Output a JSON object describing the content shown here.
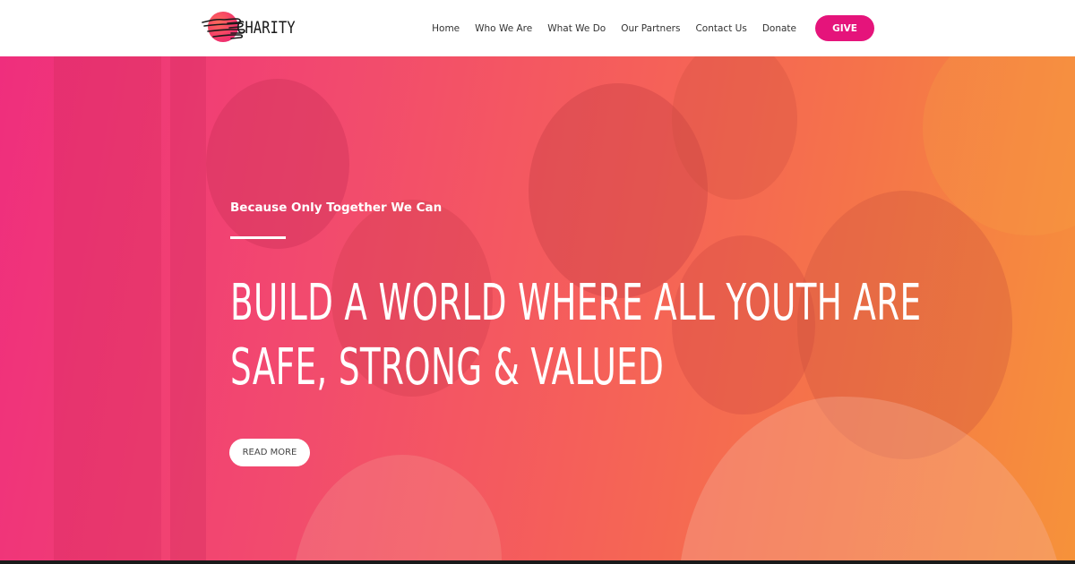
{
  "header": {
    "logo_text": "CHARITY",
    "nav": [
      {
        "label": "Home"
      },
      {
        "label": "Who We Are"
      },
      {
        "label": "What We Do"
      },
      {
        "label": "Our Partners"
      },
      {
        "label": "Contact Us"
      },
      {
        "label": "Donate"
      }
    ],
    "give_label": "GIVE"
  },
  "hero": {
    "tagline": "Because Only Together We Can",
    "headline_line1": "BUILD A WORLD WHERE ALL YOUTH ARE",
    "headline_line2": "SAFE, STRONG & VALUED",
    "read_more_label": "READ MORE"
  },
  "colors": {
    "brand_pink": "#e5147b",
    "hero_gradient_start": "#ef2e7d",
    "hero_gradient_end": "#f6923a"
  },
  "icons": {
    "logo": "hands-over-circle-icon"
  }
}
